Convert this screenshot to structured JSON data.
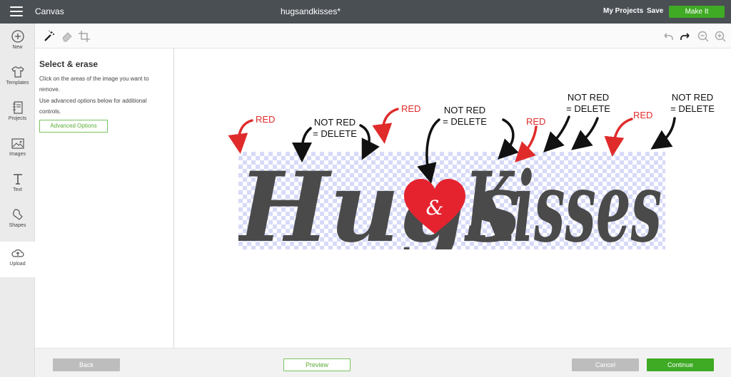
{
  "header": {
    "app_title": "Canvas",
    "doc_title": "hugsandkisses*",
    "my_projects": "My Projects",
    "save": "Save",
    "make_it": "Make It"
  },
  "rail": {
    "items": [
      {
        "label": "New",
        "icon": "plus-circle-icon"
      },
      {
        "label": "Templates",
        "icon": "tshirt-icon"
      },
      {
        "label": "Projects",
        "icon": "notebook-icon"
      },
      {
        "label": "Images",
        "icon": "image-icon"
      },
      {
        "label": "Text",
        "icon": "text-icon"
      },
      {
        "label": "Shapes",
        "icon": "shapes-icon"
      },
      {
        "label": "Upload",
        "icon": "upload-cloud-icon"
      }
    ],
    "active": "Upload"
  },
  "toolbar": {
    "tools": [
      "magic-wand-icon",
      "eraser-icon",
      "crop-icon"
    ],
    "right_tools": [
      "undo-icon",
      "redo-icon",
      "zoom-out-icon",
      "zoom-in-icon"
    ]
  },
  "panel": {
    "title": "Select & erase",
    "text1": "Click on the areas of the image you want to remove.",
    "text2": "Use advanced options below for additional controls.",
    "advanced_options": "Advanced Options"
  },
  "artwork": {
    "word_left": "Hugs",
    "ampersand": "&",
    "word_right": "Kisses",
    "heart_color": "#e5232f",
    "letter_color": "#4a4a4a"
  },
  "annotations": [
    {
      "text": "RED",
      "color": "red"
    },
    {
      "text": "NOT RED",
      "text2": "= DELETE",
      "color": "black"
    },
    {
      "text": "RED",
      "color": "red"
    },
    {
      "text": "NOT RED",
      "text2": "= DELETE",
      "color": "black"
    },
    {
      "text": "RED",
      "color": "red"
    },
    {
      "text": "NOT RED",
      "text2": "= DELETE",
      "color": "black"
    },
    {
      "text": "RED",
      "color": "red"
    },
    {
      "text": "NOT RED",
      "text2": "= DELETE",
      "color": "black"
    }
  ],
  "footer": {
    "back": "Back",
    "preview": "Preview",
    "cancel": "Cancel",
    "continue": "Continue"
  },
  "colors": {
    "topbar": "#4a4f54",
    "accent_green": "#3faa24",
    "annotation_red": "#e02b2b",
    "checker": "#d7daf7"
  }
}
